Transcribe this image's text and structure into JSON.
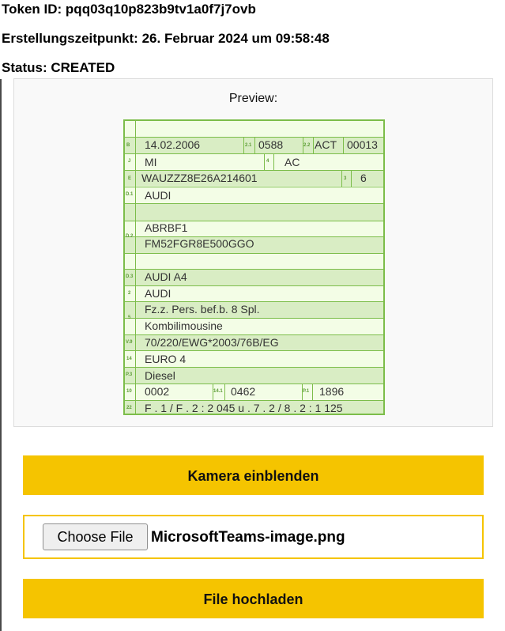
{
  "token": {
    "label": "Token ID:",
    "value": "pqq03q10p823b9tv1a0f7j7ovb"
  },
  "created": {
    "label": "Erstellungszeitpunkt:",
    "value": "26. Februar 2024 um 09:58:48"
  },
  "status": {
    "label": "Status:",
    "value": "CREATED"
  },
  "preview": {
    "label": "Preview:",
    "field_labels": {
      "b": "B",
      "f21": "2.1",
      "f22": "2.2",
      "j": "J",
      "f4": "4",
      "e": "E",
      "f3": "3",
      "d1": "D.1",
      "d2": "D.2",
      "d3": "D.3",
      "f2": "2",
      "f5": "5",
      "v9": "V.9",
      "f14": "14",
      "p3": "P.3",
      "f10": "10",
      "f143": "14.1",
      "p1": "P.1",
      "f22b": "22"
    },
    "values": {
      "date": "14.02.2006",
      "code21": "0588",
      "act": "ACT",
      "code22": "00013",
      "j": "MI",
      "f4": "AC",
      "vin": "WAUZZZ8E26A214601",
      "check": "6",
      "d1": "AUDI",
      "d2a": "ABRBF1",
      "d2b": "FM52FGR8E500GGO",
      "d3": "AUDI A4",
      "f2": "AUDI",
      "f5a": "Fz.z. Pers. bef.b. 8 Spl.",
      "f5b": "Kombilimousine",
      "v9": "70/220/EWG*2003/76B/EG",
      "f14": "EURO 4",
      "p3": "Diesel",
      "f10": "0002",
      "f141": "0462",
      "p1": "1896",
      "f22": "F . 1 / F . 2 : 2 045   u .     7 . 2 / 8 . 2 :  1 125"
    }
  },
  "camera_button": "Kamera einblenden",
  "file_input": {
    "button": "Choose File",
    "filename": "MicrosoftTeams-image.png"
  },
  "upload_button": "File hochladen",
  "colors": {
    "accent": "#f5c400",
    "doc_bg": "#f3fde6",
    "doc_border": "#7cbd4a",
    "doc_shade": "#d9edc4"
  }
}
